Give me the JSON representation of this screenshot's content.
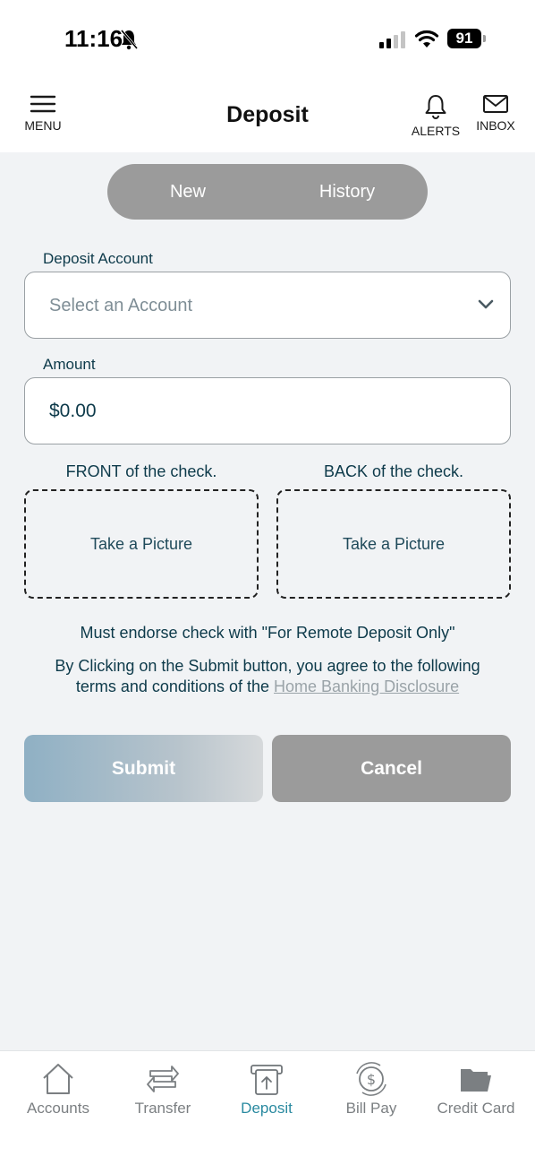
{
  "status_bar": {
    "time": "11:16",
    "battery": "91"
  },
  "header": {
    "title": "Deposit",
    "menu_label": "MENU",
    "alerts_label": "ALERTS",
    "inbox_label": "INBOX"
  },
  "segment": {
    "new_label": "New",
    "history_label": "History"
  },
  "form": {
    "account_label": "Deposit Account",
    "account_placeholder": "Select an Account",
    "amount_label": "Amount",
    "amount_value": "$0.00"
  },
  "check": {
    "front_label": "FRONT of the check.",
    "back_label": "BACK of the check.",
    "front_action": "Take a Picture",
    "back_action": "Take a Picture"
  },
  "notice": {
    "endorse": "Must endorse check with \"For Remote Deposit Only\"",
    "terms_line1": "By Clicking on the Submit button, you agree to the following",
    "terms_line2": "terms and conditions of the",
    "disclosure_link": "Home Banking Disclosure"
  },
  "buttons": {
    "submit": "Submit",
    "cancel": "Cancel"
  },
  "tabbar": {
    "items": [
      {
        "label": "Accounts",
        "icon": "house-icon"
      },
      {
        "label": "Transfer",
        "icon": "transfer-arrows-icon"
      },
      {
        "label": "Deposit",
        "icon": "deposit-icon"
      },
      {
        "label": "Bill Pay",
        "icon": "bill-pay-icon"
      },
      {
        "label": "Credit Card",
        "icon": "folder-icon"
      }
    ],
    "active": "Deposit"
  },
  "colors": {
    "accent": "#2a8aa0",
    "text": "#0d3a4a",
    "segment_bg": "#9b9b9b",
    "background": "#f1f3f5"
  }
}
